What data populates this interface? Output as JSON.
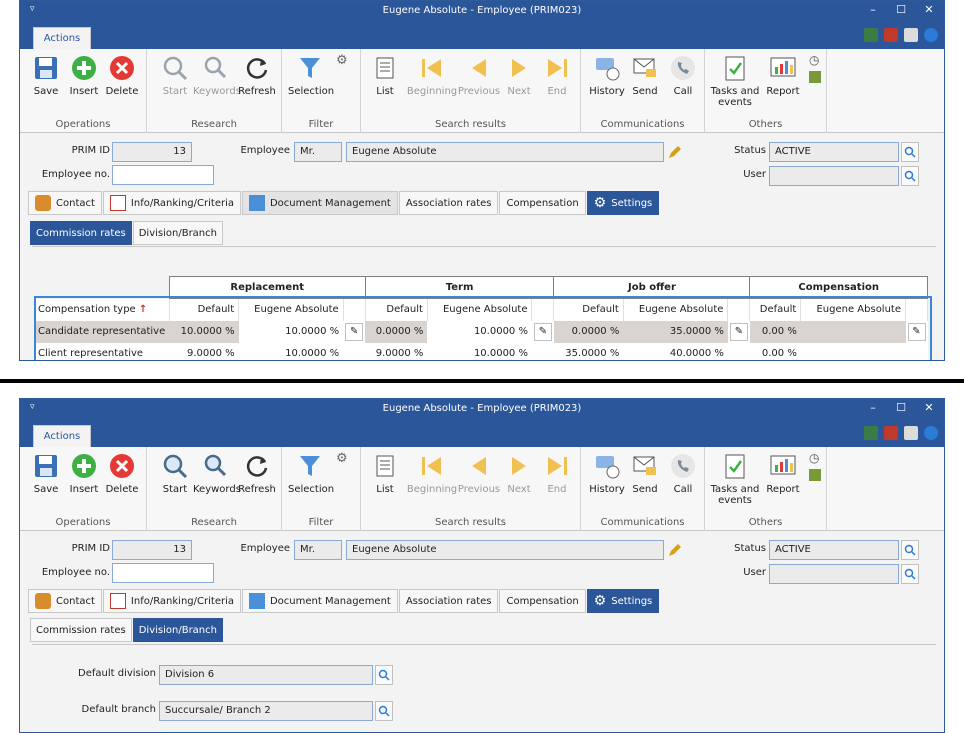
{
  "window": {
    "title": "Eugene Absolute - Employee (PRIM023)",
    "ribbon_tab": "Actions"
  },
  "ribbon": {
    "operations": {
      "label": "Operations",
      "save": "Save",
      "insert": "Insert",
      "delete": "Delete"
    },
    "research": {
      "label": "Research",
      "start": "Start",
      "keywords": "Keywords",
      "refresh": "Refresh"
    },
    "filter": {
      "label": "Filter",
      "selection": "Selection"
    },
    "search_results": {
      "label": "Search results",
      "list": "List",
      "beginning": "Beginning",
      "previous": "Previous",
      "next": "Next",
      "end": "End"
    },
    "communications": {
      "label": "Communications",
      "history": "History",
      "send": "Send",
      "call": "Call"
    },
    "others": {
      "label": "Others",
      "tasks_line1": "Tasks and",
      "tasks_line2": "events",
      "report": "Report"
    }
  },
  "form": {
    "prim_id_label": "PRIM ID",
    "prim_id": "13",
    "employee_label": "Employee",
    "salutation": "Mr.",
    "employee_name": "Eugene Absolute",
    "employee_no_label": "Employee no.",
    "employee_no": "",
    "status_label": "Status",
    "status": "ACTIVE",
    "user_label": "User",
    "user": ""
  },
  "tabs": {
    "contact": "Contact",
    "info": "Info/Ranking/Criteria",
    "docs": "Document Management",
    "assoc": "Association rates",
    "comp": "Compensation",
    "settings": "Settings"
  },
  "subtabs": {
    "commission": "Commission rates",
    "division": "Division/Branch"
  },
  "commission_grid": {
    "groups": [
      "Replacement",
      "Term",
      "Job offer",
      "Compensation"
    ],
    "type_header": "Compensation type",
    "sort_glyph": "↑",
    "default_header": "Default",
    "person_header": "Eugene Absolute",
    "rows": [
      {
        "type": "Candidate representative",
        "v": [
          "10.0000 %",
          "10.0000 %",
          "0.0000 %",
          "10.0000 %",
          "0.0000 %",
          "35.0000 %",
          "0.00 %",
          ""
        ]
      },
      {
        "type": "Client representative",
        "v": [
          "9.0000 %",
          "10.0000 %",
          "9.0000 %",
          "10.0000 %",
          "35.0000 %",
          "40.0000 %",
          "0.00 %",
          ""
        ]
      }
    ]
  },
  "division_branch": {
    "default_division_label": "Default division",
    "default_division": "Division 6",
    "default_branch_label": "Default branch",
    "default_branch": "Succursale/ Branch 2"
  },
  "colors": {
    "title_bar": "#2b579a",
    "accent": "#3a86d9"
  }
}
